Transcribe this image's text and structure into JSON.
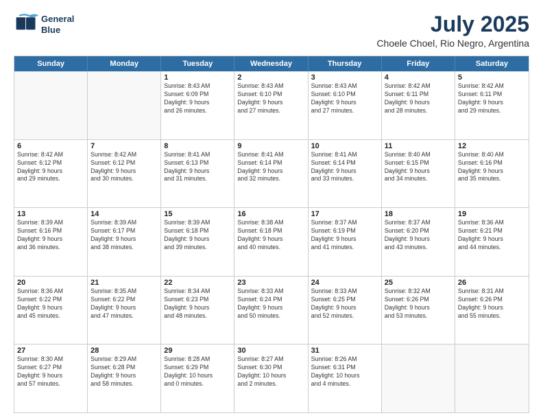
{
  "header": {
    "logo_line1": "General",
    "logo_line2": "Blue",
    "month_year": "July 2025",
    "location": "Choele Choel, Rio Negro, Argentina"
  },
  "days_of_week": [
    "Sunday",
    "Monday",
    "Tuesday",
    "Wednesday",
    "Thursday",
    "Friday",
    "Saturday"
  ],
  "weeks": [
    [
      {
        "day": "",
        "info": ""
      },
      {
        "day": "",
        "info": ""
      },
      {
        "day": "1",
        "info": "Sunrise: 8:43 AM\nSunset: 6:09 PM\nDaylight: 9 hours\nand 26 minutes."
      },
      {
        "day": "2",
        "info": "Sunrise: 8:43 AM\nSunset: 6:10 PM\nDaylight: 9 hours\nand 27 minutes."
      },
      {
        "day": "3",
        "info": "Sunrise: 8:43 AM\nSunset: 6:10 PM\nDaylight: 9 hours\nand 27 minutes."
      },
      {
        "day": "4",
        "info": "Sunrise: 8:42 AM\nSunset: 6:11 PM\nDaylight: 9 hours\nand 28 minutes."
      },
      {
        "day": "5",
        "info": "Sunrise: 8:42 AM\nSunset: 6:11 PM\nDaylight: 9 hours\nand 29 minutes."
      }
    ],
    [
      {
        "day": "6",
        "info": "Sunrise: 8:42 AM\nSunset: 6:12 PM\nDaylight: 9 hours\nand 29 minutes."
      },
      {
        "day": "7",
        "info": "Sunrise: 8:42 AM\nSunset: 6:12 PM\nDaylight: 9 hours\nand 30 minutes."
      },
      {
        "day": "8",
        "info": "Sunrise: 8:41 AM\nSunset: 6:13 PM\nDaylight: 9 hours\nand 31 minutes."
      },
      {
        "day": "9",
        "info": "Sunrise: 8:41 AM\nSunset: 6:14 PM\nDaylight: 9 hours\nand 32 minutes."
      },
      {
        "day": "10",
        "info": "Sunrise: 8:41 AM\nSunset: 6:14 PM\nDaylight: 9 hours\nand 33 minutes."
      },
      {
        "day": "11",
        "info": "Sunrise: 8:40 AM\nSunset: 6:15 PM\nDaylight: 9 hours\nand 34 minutes."
      },
      {
        "day": "12",
        "info": "Sunrise: 8:40 AM\nSunset: 6:16 PM\nDaylight: 9 hours\nand 35 minutes."
      }
    ],
    [
      {
        "day": "13",
        "info": "Sunrise: 8:39 AM\nSunset: 6:16 PM\nDaylight: 9 hours\nand 36 minutes."
      },
      {
        "day": "14",
        "info": "Sunrise: 8:39 AM\nSunset: 6:17 PM\nDaylight: 9 hours\nand 38 minutes."
      },
      {
        "day": "15",
        "info": "Sunrise: 8:39 AM\nSunset: 6:18 PM\nDaylight: 9 hours\nand 39 minutes."
      },
      {
        "day": "16",
        "info": "Sunrise: 8:38 AM\nSunset: 6:18 PM\nDaylight: 9 hours\nand 40 minutes."
      },
      {
        "day": "17",
        "info": "Sunrise: 8:37 AM\nSunset: 6:19 PM\nDaylight: 9 hours\nand 41 minutes."
      },
      {
        "day": "18",
        "info": "Sunrise: 8:37 AM\nSunset: 6:20 PM\nDaylight: 9 hours\nand 43 minutes."
      },
      {
        "day": "19",
        "info": "Sunrise: 8:36 AM\nSunset: 6:21 PM\nDaylight: 9 hours\nand 44 minutes."
      }
    ],
    [
      {
        "day": "20",
        "info": "Sunrise: 8:36 AM\nSunset: 6:22 PM\nDaylight: 9 hours\nand 45 minutes."
      },
      {
        "day": "21",
        "info": "Sunrise: 8:35 AM\nSunset: 6:22 PM\nDaylight: 9 hours\nand 47 minutes."
      },
      {
        "day": "22",
        "info": "Sunrise: 8:34 AM\nSunset: 6:23 PM\nDaylight: 9 hours\nand 48 minutes."
      },
      {
        "day": "23",
        "info": "Sunrise: 8:33 AM\nSunset: 6:24 PM\nDaylight: 9 hours\nand 50 minutes."
      },
      {
        "day": "24",
        "info": "Sunrise: 8:33 AM\nSunset: 6:25 PM\nDaylight: 9 hours\nand 52 minutes."
      },
      {
        "day": "25",
        "info": "Sunrise: 8:32 AM\nSunset: 6:26 PM\nDaylight: 9 hours\nand 53 minutes."
      },
      {
        "day": "26",
        "info": "Sunrise: 8:31 AM\nSunset: 6:26 PM\nDaylight: 9 hours\nand 55 minutes."
      }
    ],
    [
      {
        "day": "27",
        "info": "Sunrise: 8:30 AM\nSunset: 6:27 PM\nDaylight: 9 hours\nand 57 minutes."
      },
      {
        "day": "28",
        "info": "Sunrise: 8:29 AM\nSunset: 6:28 PM\nDaylight: 9 hours\nand 58 minutes."
      },
      {
        "day": "29",
        "info": "Sunrise: 8:28 AM\nSunset: 6:29 PM\nDaylight: 10 hours\nand 0 minutes."
      },
      {
        "day": "30",
        "info": "Sunrise: 8:27 AM\nSunset: 6:30 PM\nDaylight: 10 hours\nand 2 minutes."
      },
      {
        "day": "31",
        "info": "Sunrise: 8:26 AM\nSunset: 6:31 PM\nDaylight: 10 hours\nand 4 minutes."
      },
      {
        "day": "",
        "info": ""
      },
      {
        "day": "",
        "info": ""
      }
    ]
  ]
}
